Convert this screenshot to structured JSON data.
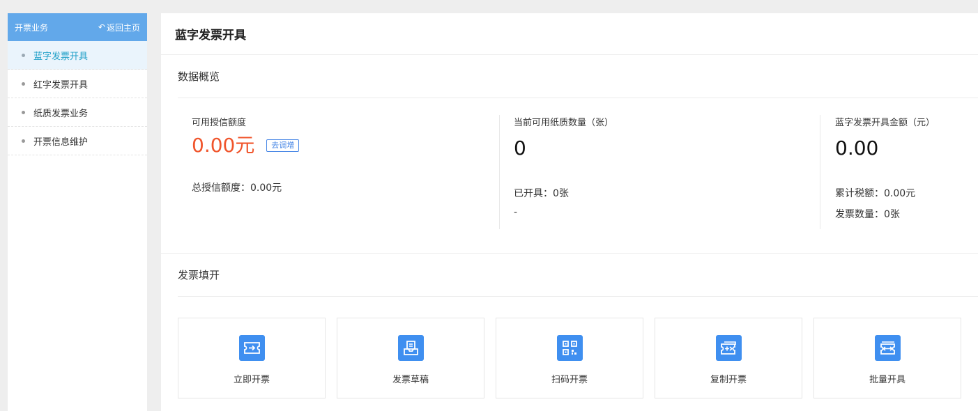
{
  "sidebar": {
    "title": "开票业务",
    "back_label": "返回主页",
    "items": [
      {
        "label": "蓝字发票开具"
      },
      {
        "label": "红字发票开具"
      },
      {
        "label": "纸质发票业务"
      },
      {
        "label": "开票信息维护"
      }
    ]
  },
  "page": {
    "title": "蓝字发票开具"
  },
  "overview": {
    "title": "数据概览",
    "credit": {
      "label": "可用授信额度",
      "value": "0.00元",
      "adjust_label": "去调增",
      "total": "总授信额度：0.00元"
    },
    "paper": {
      "label": "当前可用纸质数量（张）",
      "value": "0",
      "issued": "已开具：0张",
      "extra": "-"
    },
    "amount": {
      "label": "蓝字发票开具金额（元）",
      "value": "0.00",
      "tax": "累计税额：0.00元",
      "count": "发票数量：0张"
    }
  },
  "fill": {
    "title": "发票填开",
    "actions": [
      {
        "label": "立即开票",
        "icon": "ticket-arrow-icon"
      },
      {
        "label": "发票草稿",
        "icon": "draft-tray-icon"
      },
      {
        "label": "扫码开票",
        "icon": "qr-code-icon"
      },
      {
        "label": "复制开票",
        "icon": "copy-ticket-icon"
      },
      {
        "label": "批量开具",
        "icon": "batch-ticket-icon"
      }
    ]
  },
  "colors": {
    "header_blue": "#62a8ea",
    "accent_red": "#f0552c",
    "icon_blue": "#3f8ff0",
    "active_text": "#21a0c8"
  }
}
